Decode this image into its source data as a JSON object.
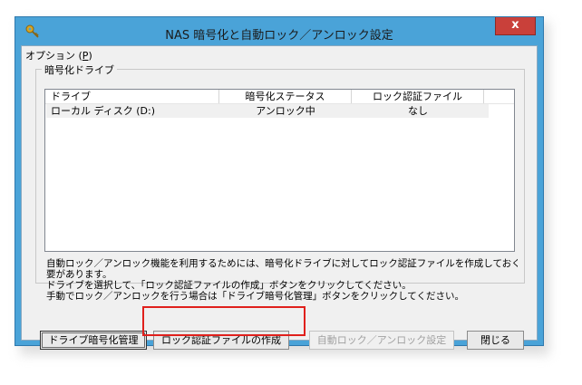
{
  "window": {
    "title": "NAS 暗号化と自動ロック／アンロック設定",
    "close_label": "x"
  },
  "menu": {
    "options_label_prefix": "オプション (",
    "options_label_key": "P",
    "options_label_suffix": ")"
  },
  "group": {
    "title": "暗号化ドライブ"
  },
  "list": {
    "columns": [
      "ドライブ",
      "暗号化ステータス",
      "ロック認証ファイル"
    ],
    "rows": [
      {
        "drive": "ローカル ディスク (D:)",
        "status": "アンロック中",
        "auth_file": "なし"
      }
    ]
  },
  "info": {
    "lines": [
      "自動ロック／アンロック機能を利用するためには、暗号化ドライブに対してロック認証ファイルを作成しておく必",
      "要があります。",
      "ドライブを選択して、「ロック認証ファイルの作成」ボタンをクリックしてください。",
      "手動でロック／アンロックを行う場合は「ドライブ暗号化管理」ボタンをクリックしてください。"
    ]
  },
  "buttons": {
    "drive_mgmt": "ドライブ暗号化管理",
    "create_auth": "ロック認証ファイルの作成",
    "auto_lock": "自動ロック／アンロック設定",
    "close": "閉じる"
  },
  "colors": {
    "titlebar": "#4aa3d8",
    "close_button": "#c9403a",
    "highlight": "#e0201c"
  }
}
